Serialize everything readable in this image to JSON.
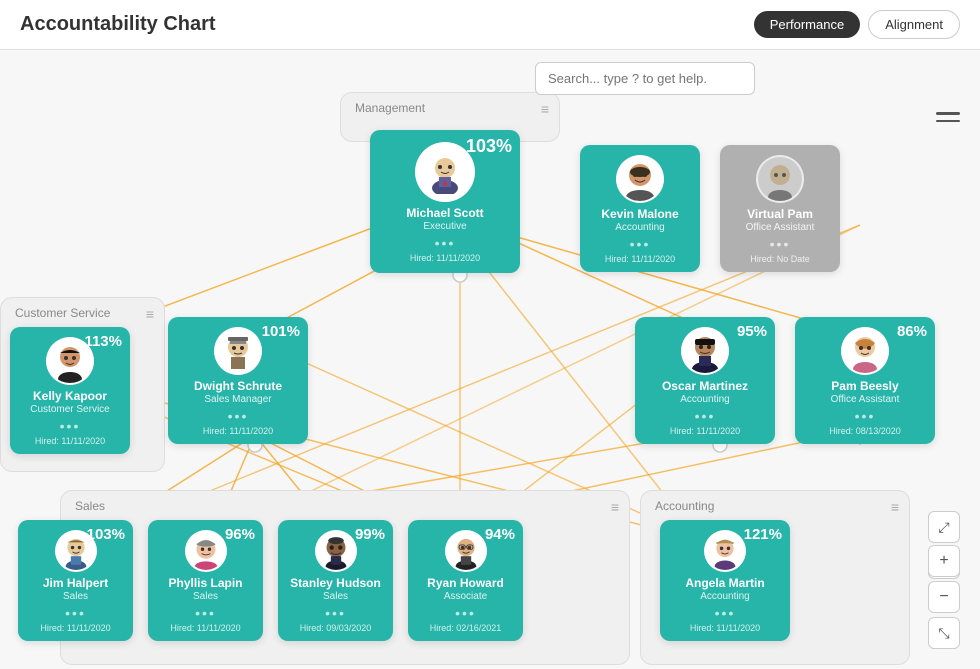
{
  "header": {
    "title": "Accountability Chart",
    "btn_performance": "Performance",
    "btn_alignment": "Alignment"
  },
  "search": {
    "placeholder": "Search... type ? to get help."
  },
  "employees": {
    "michael": {
      "name": "Michael Scott",
      "role": "Executive",
      "percent": "103%",
      "hired": "Hired: 11/11/2020"
    },
    "kevin": {
      "name": "Kevin Malone",
      "role": "Accounting",
      "percent": "",
      "hired": "Hired: 11/11/2020"
    },
    "virtual_pam": {
      "name": "Virtual Pam",
      "role": "Office Assistant",
      "percent": "",
      "hired": "Hired: No Date"
    },
    "dwight": {
      "name": "Dwight Schrute",
      "role": "Sales Manager",
      "percent": "101%",
      "hired": "Hired: 11/11/2020"
    },
    "oscar": {
      "name": "Oscar Martinez",
      "role": "Accounting",
      "percent": "95%",
      "hired": "Hired: 11/11/2020"
    },
    "pam": {
      "name": "Pam Beesly",
      "role": "Office Assistant",
      "percent": "86%",
      "hired": "Hired: 08/13/2020"
    },
    "kelly": {
      "name": "Kelly Kapoor",
      "role": "Customer Service",
      "percent": "113%",
      "hired": "Hired: 11/11/2020"
    },
    "jim": {
      "name": "Jim Halpert",
      "role": "Sales",
      "percent": "103%",
      "hired": "Hired: 11/11/2020"
    },
    "phyllis": {
      "name": "Phyllis Lapin",
      "role": "Sales",
      "percent": "96%",
      "hired": "Hired: 11/11/2020"
    },
    "stanley": {
      "name": "Stanley Hudson",
      "role": "Sales",
      "percent": "99%",
      "hired": "Hired: 09/03/2020"
    },
    "ryan": {
      "name": "Ryan Howard",
      "role": "Associate",
      "percent": "94%",
      "hired": "Hired: 02/16/2021"
    },
    "angela": {
      "name": "Angela Martin",
      "role": "Accounting",
      "percent": "121%",
      "hired": "Hired: 11/11/2020"
    }
  },
  "groups": {
    "management": "Management",
    "customer_service": "Customer Service",
    "sales": "Sales",
    "accounting": "Accounting"
  },
  "zoom": {
    "plus": "+",
    "minus": "−"
  },
  "dots": "•••"
}
